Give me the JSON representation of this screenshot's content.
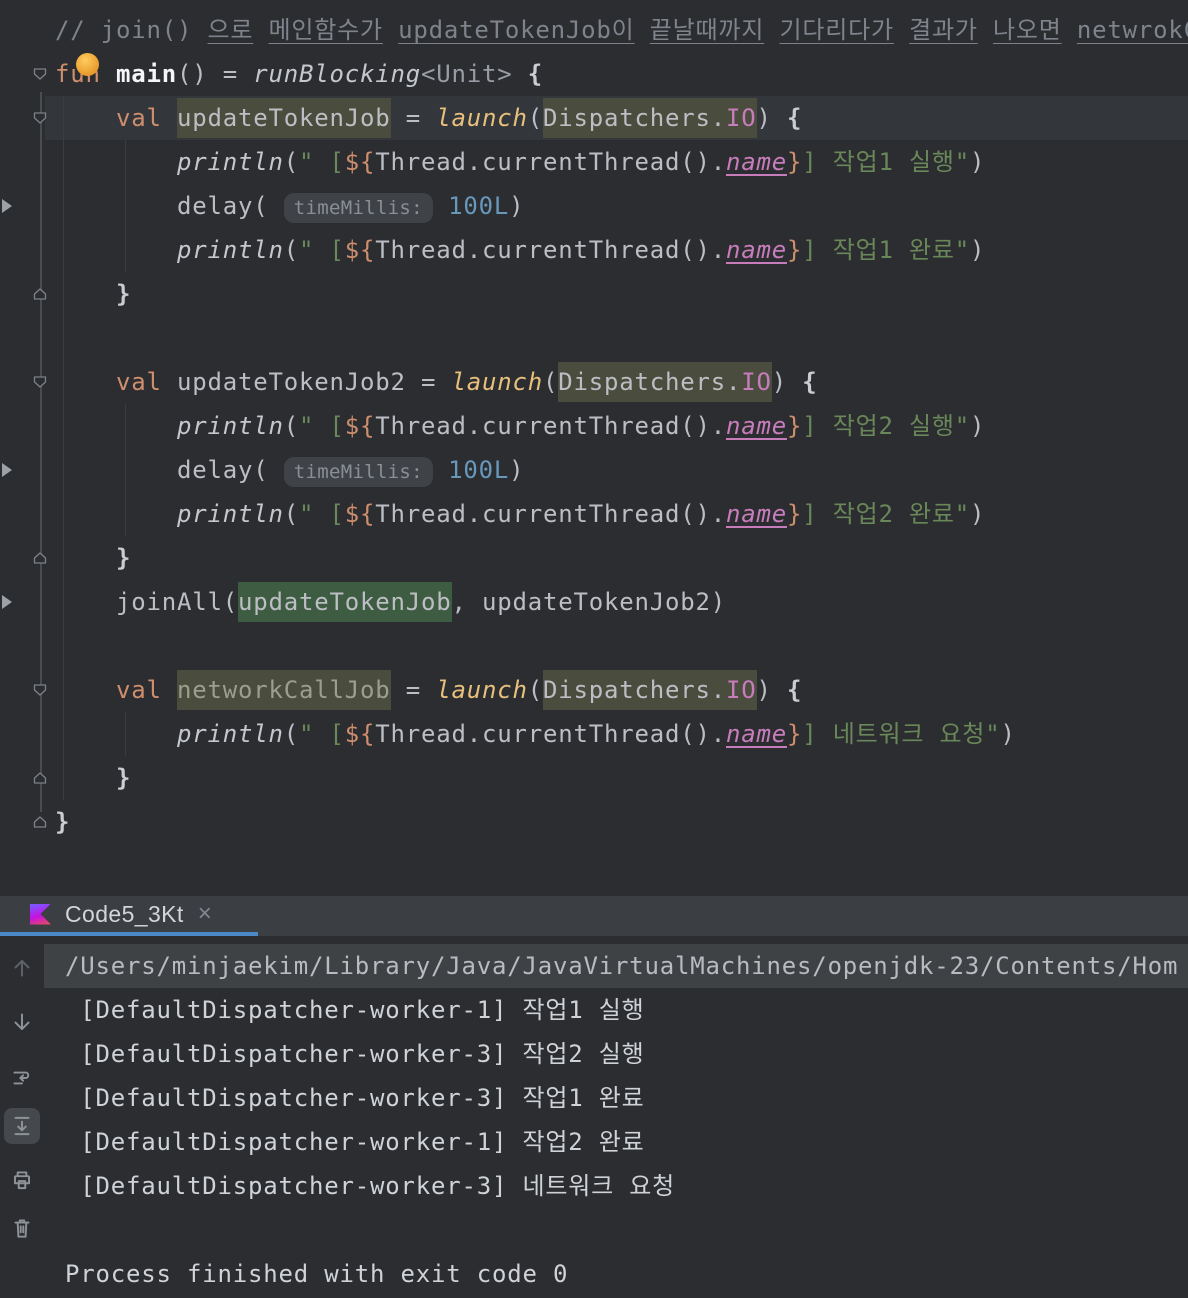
{
  "colors": {
    "editor_background": "#2B2D30",
    "caret_line": "#33363B",
    "keyword_orange": "#CF8E6D",
    "string_green": "#6A8759",
    "number_blue": "#6897BB",
    "property_purple": "#C77DBB",
    "comment_gray": "#7F848C",
    "identifier_highlight_olive": "#4A4C3E",
    "usage_highlight_green": "#3E5C42",
    "tab_bar_background": "#3B3E42",
    "active_tab_indicator_blue": "#4A88C7",
    "console_command_line_band": "#3E4245",
    "intention_bulb_orange": "#E89A2B"
  },
  "editor": {
    "lines": [
      {
        "segments": [
          {
            "t": "// join() ",
            "s": "comment"
          },
          {
            "t": "으로",
            "s": "comment-u"
          },
          {
            "t": " ",
            "s": "comment"
          },
          {
            "t": "메인함수가",
            "s": "comment-u"
          },
          {
            "t": " ",
            "s": "comment"
          },
          {
            "t": "updateTokenJob이",
            "s": "comment-u"
          },
          {
            "t": " ",
            "s": "comment"
          },
          {
            "t": "끝날때까지",
            "s": "comment-u"
          },
          {
            "t": " ",
            "s": "comment"
          },
          {
            "t": "기다리다가",
            "s": "comment-u"
          },
          {
            "t": " ",
            "s": "comment"
          },
          {
            "t": "결과가",
            "s": "comment-u"
          },
          {
            "t": " ",
            "s": "comment"
          },
          {
            "t": "나오면",
            "s": "comment-u"
          },
          {
            "t": " ",
            "s": "comment"
          },
          {
            "t": "netwrokC",
            "s": "comment-u"
          }
        ]
      },
      {
        "fold": "start",
        "segments": [
          {
            "t": "fun",
            "s": "kw"
          },
          {
            "t": " ",
            "s": "plain"
          },
          {
            "t": "main",
            "s": "fn"
          },
          {
            "t": "() = ",
            "s": "plain"
          },
          {
            "t": "runBlocking",
            "s": "call"
          },
          {
            "t": "<Unit>",
            "s": "type"
          },
          {
            "t": " ",
            "s": "plain"
          },
          {
            "t": "{",
            "s": "brace"
          }
        ]
      },
      {
        "fold": "start",
        "caret": true,
        "segments": [
          {
            "t": "    ",
            "s": "plain"
          },
          {
            "t": "val",
            "s": "kw"
          },
          {
            "t": " ",
            "s": "plain"
          },
          {
            "t": "updateTokenJob",
            "s": "plain",
            "h": "olive"
          },
          {
            "t": " = ",
            "s": "plain"
          },
          {
            "t": "launch",
            "s": "call-gold"
          },
          {
            "t": "(",
            "s": "plain"
          },
          {
            "t": "Dispatchers.",
            "s": "plain",
            "h": "olive"
          },
          {
            "t": "IO",
            "s": "const",
            "h": "olive"
          },
          {
            "t": ") ",
            "s": "plain"
          },
          {
            "t": "{",
            "s": "brace"
          }
        ]
      },
      {
        "segments": [
          {
            "t": "        ",
            "s": "plain"
          },
          {
            "t": "println",
            "s": "call"
          },
          {
            "t": "(",
            "s": "plain"
          },
          {
            "t": "\" [",
            "s": "str"
          },
          {
            "t": "${",
            "s": "tpl"
          },
          {
            "t": "Thread.currentThread().",
            "s": "plain"
          },
          {
            "t": "name",
            "s": "prop"
          },
          {
            "t": "}",
            "s": "tpl"
          },
          {
            "t": "] 작업1 실행\"",
            "s": "str"
          },
          {
            "t": ")",
            "s": "plain"
          }
        ]
      },
      {
        "suspend": true,
        "segments": [
          {
            "t": "        ",
            "s": "plain"
          },
          {
            "t": "delay",
            "s": "plain"
          },
          {
            "t": "(",
            "s": "plain"
          },
          {
            "t": " ",
            "s": "plain"
          },
          {
            "t": "timeMillis:",
            "s": "hint"
          },
          {
            "t": " ",
            "s": "plain"
          },
          {
            "t": "100L",
            "s": "num"
          },
          {
            "t": ")",
            "s": "plain"
          }
        ]
      },
      {
        "segments": [
          {
            "t": "        ",
            "s": "plain"
          },
          {
            "t": "println",
            "s": "call"
          },
          {
            "t": "(",
            "s": "plain"
          },
          {
            "t": "\" [",
            "s": "str"
          },
          {
            "t": "${",
            "s": "tpl"
          },
          {
            "t": "Thread.currentThread().",
            "s": "plain"
          },
          {
            "t": "name",
            "s": "prop"
          },
          {
            "t": "}",
            "s": "tpl"
          },
          {
            "t": "] 작업1 완료\"",
            "s": "str"
          },
          {
            "t": ")",
            "s": "plain"
          }
        ]
      },
      {
        "fold": "end",
        "segments": [
          {
            "t": "    ",
            "s": "plain"
          },
          {
            "t": "}",
            "s": "brace"
          }
        ]
      },
      {
        "segments": []
      },
      {
        "fold": "start",
        "segments": [
          {
            "t": "    ",
            "s": "plain"
          },
          {
            "t": "val",
            "s": "kw"
          },
          {
            "t": " ",
            "s": "plain"
          },
          {
            "t": "updateTokenJob2",
            "s": "plain"
          },
          {
            "t": " = ",
            "s": "plain"
          },
          {
            "t": "launch",
            "s": "call-gold"
          },
          {
            "t": "(",
            "s": "plain"
          },
          {
            "t": "Dispatchers.",
            "s": "plain",
            "h": "olive"
          },
          {
            "t": "IO",
            "s": "const",
            "h": "olive"
          },
          {
            "t": ") ",
            "s": "plain"
          },
          {
            "t": "{",
            "s": "brace"
          }
        ]
      },
      {
        "segments": [
          {
            "t": "        ",
            "s": "plain"
          },
          {
            "t": "println",
            "s": "call"
          },
          {
            "t": "(",
            "s": "plain"
          },
          {
            "t": "\" [",
            "s": "str"
          },
          {
            "t": "${",
            "s": "tpl"
          },
          {
            "t": "Thread.currentThread().",
            "s": "plain"
          },
          {
            "t": "name",
            "s": "prop"
          },
          {
            "t": "}",
            "s": "tpl"
          },
          {
            "t": "] 작업2 실행\"",
            "s": "str"
          },
          {
            "t": ")",
            "s": "plain"
          }
        ]
      },
      {
        "suspend": true,
        "segments": [
          {
            "t": "        ",
            "s": "plain"
          },
          {
            "t": "delay",
            "s": "plain"
          },
          {
            "t": "(",
            "s": "plain"
          },
          {
            "t": " ",
            "s": "plain"
          },
          {
            "t": "timeMillis:",
            "s": "hint"
          },
          {
            "t": " ",
            "s": "plain"
          },
          {
            "t": "100L",
            "s": "num"
          },
          {
            "t": ")",
            "s": "plain"
          }
        ]
      },
      {
        "segments": [
          {
            "t": "        ",
            "s": "plain"
          },
          {
            "t": "println",
            "s": "call"
          },
          {
            "t": "(",
            "s": "plain"
          },
          {
            "t": "\" [",
            "s": "str"
          },
          {
            "t": "${",
            "s": "tpl"
          },
          {
            "t": "Thread.currentThread().",
            "s": "plain"
          },
          {
            "t": "name",
            "s": "prop"
          },
          {
            "t": "}",
            "s": "tpl"
          },
          {
            "t": "] 작업2 완료\"",
            "s": "str"
          },
          {
            "t": ")",
            "s": "plain"
          }
        ]
      },
      {
        "fold": "end",
        "segments": [
          {
            "t": "    ",
            "s": "plain"
          },
          {
            "t": "}",
            "s": "brace"
          }
        ]
      },
      {
        "suspend": true,
        "segments": [
          {
            "t": "    ",
            "s": "plain"
          },
          {
            "t": "joinAll",
            "s": "plain"
          },
          {
            "t": "(",
            "s": "plain"
          },
          {
            "t": "updateTokenJob",
            "s": "plain",
            "h": "green"
          },
          {
            "t": ", updateTokenJob2)",
            "s": "plain"
          }
        ]
      },
      {
        "segments": []
      },
      {
        "fold": "start",
        "segments": [
          {
            "t": "    ",
            "s": "plain"
          },
          {
            "t": "val",
            "s": "kw"
          },
          {
            "t": " ",
            "s": "plain"
          },
          {
            "t": "networkCallJob",
            "s": "unused",
            "h": "olive"
          },
          {
            "t": " = ",
            "s": "plain"
          },
          {
            "t": "launch",
            "s": "call-gold"
          },
          {
            "t": "(",
            "s": "plain"
          },
          {
            "t": "Dispatchers.",
            "s": "plain",
            "h": "olive"
          },
          {
            "t": "IO",
            "s": "const",
            "h": "olive"
          },
          {
            "t": ") ",
            "s": "plain"
          },
          {
            "t": "{",
            "s": "brace"
          }
        ]
      },
      {
        "segments": [
          {
            "t": "        ",
            "s": "plain"
          },
          {
            "t": "println",
            "s": "call"
          },
          {
            "t": "(",
            "s": "plain"
          },
          {
            "t": "\" [",
            "s": "str"
          },
          {
            "t": "${",
            "s": "tpl"
          },
          {
            "t": "Thread.currentThread().",
            "s": "plain"
          },
          {
            "t": "name",
            "s": "prop"
          },
          {
            "t": "}",
            "s": "tpl"
          },
          {
            "t": "] 네트워크 요청\"",
            "s": "str"
          },
          {
            "t": ")",
            "s": "plain"
          }
        ]
      },
      {
        "fold": "end",
        "segments": [
          {
            "t": "    ",
            "s": "plain"
          },
          {
            "t": "}",
            "s": "brace"
          }
        ]
      },
      {
        "fold": "end",
        "segments": [
          {
            "t": "}",
            "s": "brace"
          }
        ]
      }
    ]
  },
  "run_panel": {
    "tab": {
      "label": "Code5_3Kt",
      "close_glyph": "×"
    },
    "toolbar": [
      {
        "name": "arrow-up",
        "dim": true,
        "selected": false
      },
      {
        "name": "arrow-down",
        "dim": false,
        "selected": false
      },
      {
        "name": "soft-wrap",
        "dim": false,
        "selected": false
      },
      {
        "name": "scroll-to-end",
        "dim": false,
        "selected": true
      },
      {
        "name": "print",
        "dim": false,
        "selected": false
      },
      {
        "name": "clear",
        "dim": false,
        "selected": false
      }
    ],
    "console": {
      "lines": [
        {
          "text": "/Users/minjaekim/Library/Java/JavaVirtualMachines/openjdk-23/Contents/Hom",
          "style": "path"
        },
        {
          "text": " [DefaultDispatcher-worker-1] 작업1 실행",
          "style": "out"
        },
        {
          "text": " [DefaultDispatcher-worker-3] 작업2 실행",
          "style": "out"
        },
        {
          "text": " [DefaultDispatcher-worker-3] 작업1 완료",
          "style": "out"
        },
        {
          "text": " [DefaultDispatcher-worker-1] 작업2 완료",
          "style": "out"
        },
        {
          "text": " [DefaultDispatcher-worker-3] 네트워크 요청",
          "style": "out"
        },
        {
          "text": "",
          "style": "out"
        },
        {
          "text": "Process finished with exit code 0",
          "style": "out"
        }
      ]
    }
  }
}
